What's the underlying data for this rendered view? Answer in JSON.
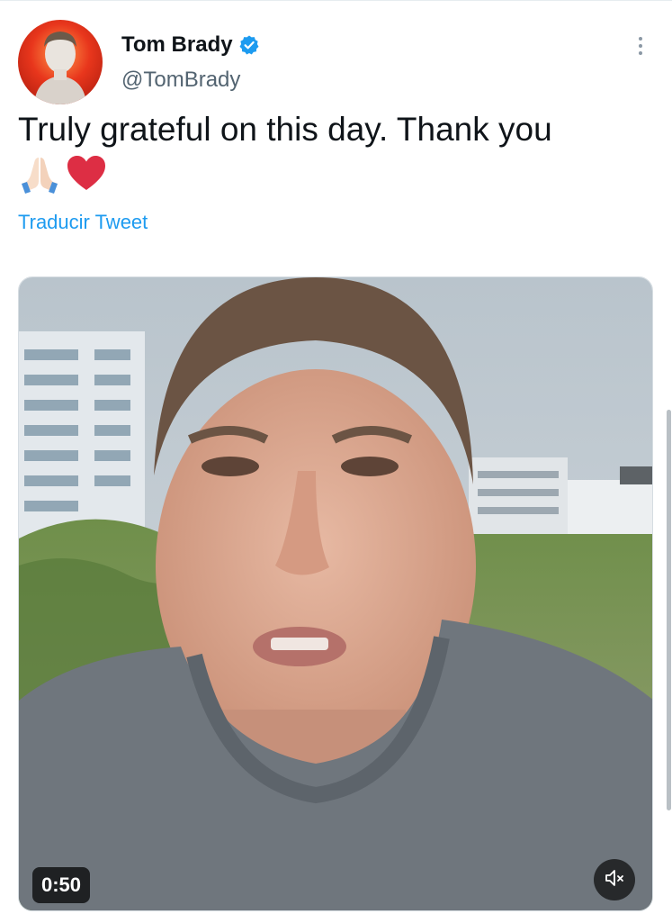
{
  "author": {
    "display_name": "Tom Brady",
    "handle": "@TomBrady",
    "verified": true
  },
  "tweet": {
    "text": "Truly grateful on this day. Thank you",
    "emojis": [
      "folded-hands-emoji",
      "red-heart-emoji"
    ],
    "translate_label": "Traducir Tweet"
  },
  "media": {
    "type": "video",
    "duration": "0:50",
    "muted": true
  },
  "colors": {
    "link": "#1d9bf0",
    "verified_badge": "#1d9bf0",
    "text_primary": "#0f1419",
    "text_secondary": "#536471"
  },
  "icons": {
    "more": "more-options-icon",
    "verified": "verified-badge-icon",
    "mute": "speaker-muted-icon"
  }
}
